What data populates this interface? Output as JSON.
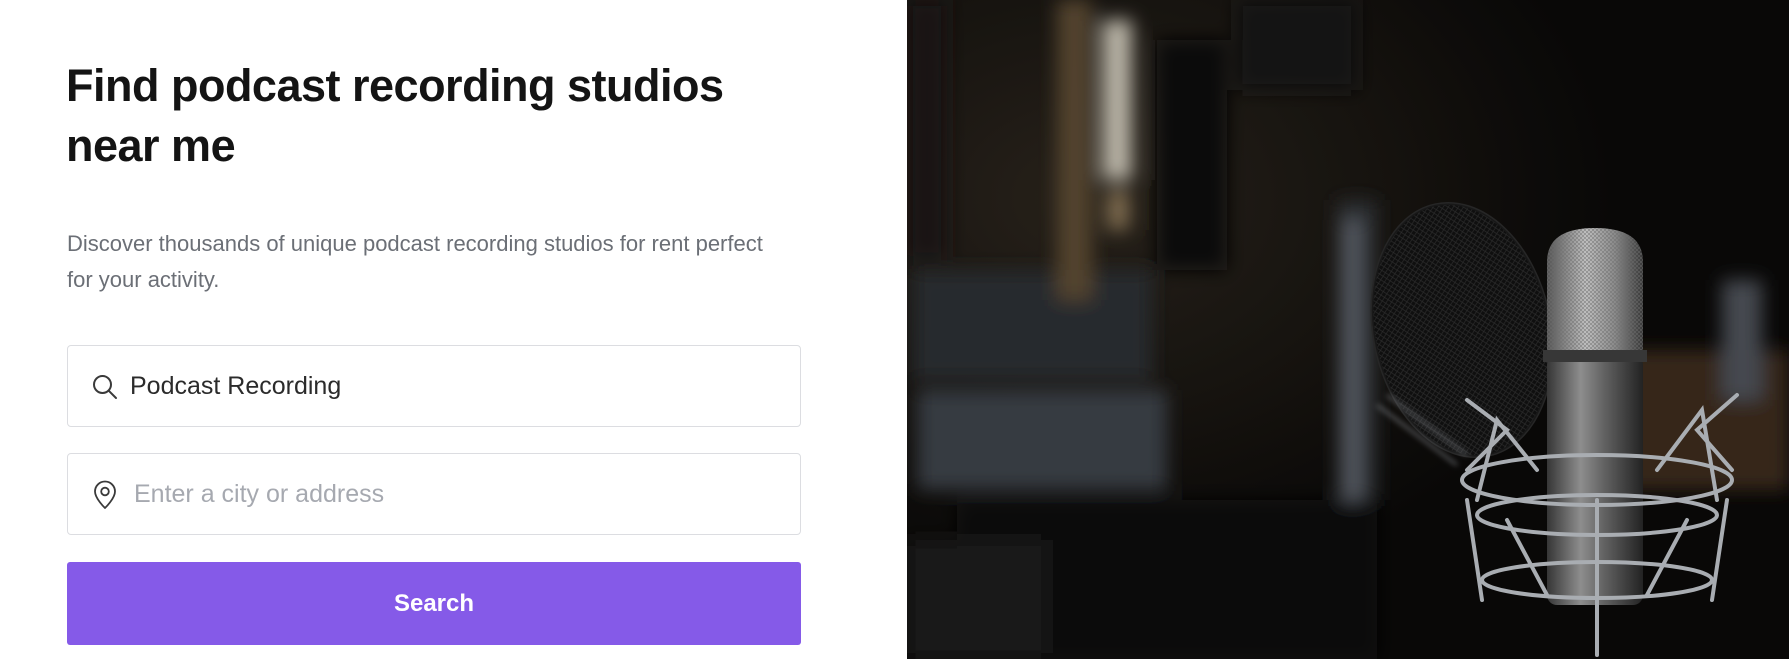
{
  "hero": {
    "title": "Find podcast recording studios near me",
    "subtitle": "Discover thousands of unique podcast recording studios for rent perfect for your activity."
  },
  "search_form": {
    "activity": {
      "icon": "search-icon",
      "value": "Podcast Recording"
    },
    "location": {
      "icon": "location-pin-icon",
      "placeholder": "Enter a city or address",
      "value": ""
    },
    "submit_label": "Search"
  },
  "colors": {
    "accent": "#855ae8",
    "title": "#141414",
    "subtitle": "#6b6f76",
    "placeholder": "#a6a9b0",
    "border": "#dcdde1"
  },
  "photo": {
    "subject": "studio microphone with pop filter"
  }
}
